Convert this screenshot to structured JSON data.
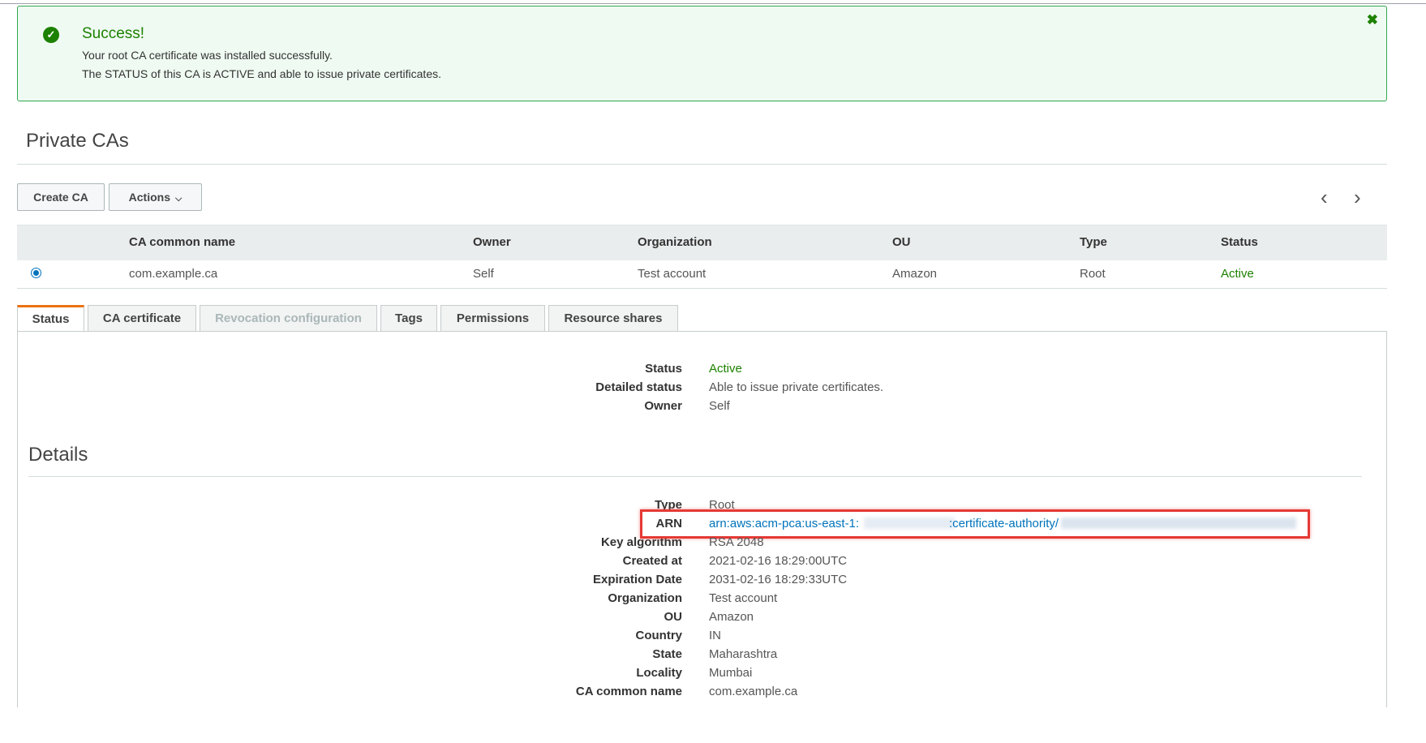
{
  "flash": {
    "title": "Success!",
    "message_line1": "Your root CA certificate was installed successfully.",
    "message_line2": "The STATUS of this CA is ACTIVE and able to issue private certificates.",
    "close_glyph": "✖",
    "icon": "check-circle-icon"
  },
  "page": {
    "title": "Private CAs"
  },
  "toolbar": {
    "create_label": "Create CA",
    "actions_label": "Actions",
    "actions_chevron": "⌵",
    "prev_glyph": "‹",
    "next_glyph": "›"
  },
  "table": {
    "headers": [
      "CA common name",
      "Owner",
      "Organization",
      "OU",
      "Type",
      "Status"
    ],
    "rows": [
      {
        "common_name": "com.example.ca",
        "owner": "Self",
        "organization": "Test account",
        "ou": "Amazon",
        "type": "Root",
        "status": "Active"
      }
    ]
  },
  "tabs": [
    {
      "label": "Status",
      "state": "active"
    },
    {
      "label": "CA certificate",
      "state": "normal"
    },
    {
      "label": "Revocation configuration",
      "state": "disabled"
    },
    {
      "label": "Tags",
      "state": "normal"
    },
    {
      "label": "Permissions",
      "state": "normal"
    },
    {
      "label": "Resource shares",
      "state": "normal"
    }
  ],
  "status_section": {
    "status_label": "Status",
    "status_value": "Active",
    "detailed_label": "Detailed status",
    "detailed_value": "Able to issue private certificates.",
    "owner_label": "Owner",
    "owner_value": "Self"
  },
  "details": {
    "title": "Details",
    "type_label": "Type",
    "type_value": "Root",
    "arn_label": "ARN",
    "arn_value_start": "arn:aws:acm-pca:us-east-1:",
    "arn_value_mid": ":certificate-authority/",
    "key_algorithm_label": "Key algorithm",
    "key_algorithm_value": "RSA 2048",
    "created_label": "Created at",
    "created_value": "2021-02-16 18:29:00UTC",
    "expiration_label": "Expiration Date",
    "expiration_value": "2031-02-16 18:29:33UTC",
    "organization_label": "Organization",
    "organization_value": "Test account",
    "ou_label": "OU",
    "ou_value": "Amazon",
    "country_label": "Country",
    "country_value": "IN",
    "state_label": "State",
    "state_value": "Maharashtra",
    "locality_label": "Locality",
    "locality_value": "Mumbai",
    "cn_label": "CA common name",
    "cn_value": "com.example.ca"
  },
  "colors": {
    "success_green": "#1d8102",
    "link_blue": "#0073bb",
    "tab_accent": "#ec7211",
    "highlight_red": "#e53935"
  }
}
